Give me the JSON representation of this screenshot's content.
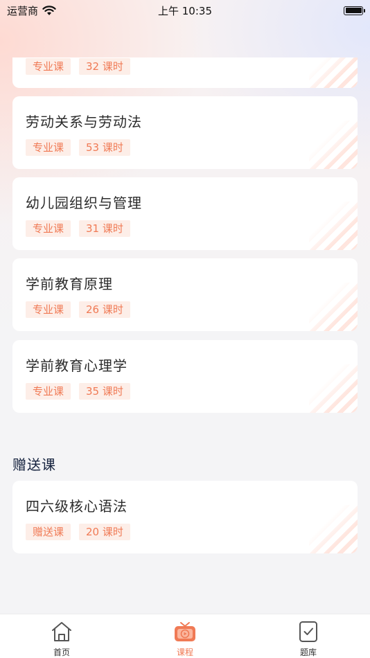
{
  "status_bar": {
    "carrier": "运营商",
    "time": "上午 10:35"
  },
  "courses": [
    {
      "title": "",
      "type_tag": "专业课",
      "hours_tag": "32 课时"
    },
    {
      "title": "劳动关系与劳动法",
      "type_tag": "专业课",
      "hours_tag": "53 课时"
    },
    {
      "title": "幼儿园组织与管理",
      "type_tag": "专业课",
      "hours_tag": "31 课时"
    },
    {
      "title": "学前教育原理",
      "type_tag": "专业课",
      "hours_tag": "26 课时"
    },
    {
      "title": "学前教育心理学",
      "type_tag": "专业课",
      "hours_tag": "35 课时"
    }
  ],
  "gift_section": {
    "title": "赠送课",
    "courses": [
      {
        "title": "四六级核心语法",
        "type_tag": "赠送课",
        "hours_tag": "20 课时"
      }
    ]
  },
  "tab_bar": {
    "items": [
      {
        "label": "首页",
        "icon": "home-icon"
      },
      {
        "label": "课程",
        "icon": "course-tv-icon"
      },
      {
        "label": "题库",
        "icon": "question-bank-icon"
      }
    ],
    "active_index": 1
  },
  "colors": {
    "accent": "#f07a55",
    "tag_bg": "#fdeee8",
    "heading": "#14213d"
  }
}
